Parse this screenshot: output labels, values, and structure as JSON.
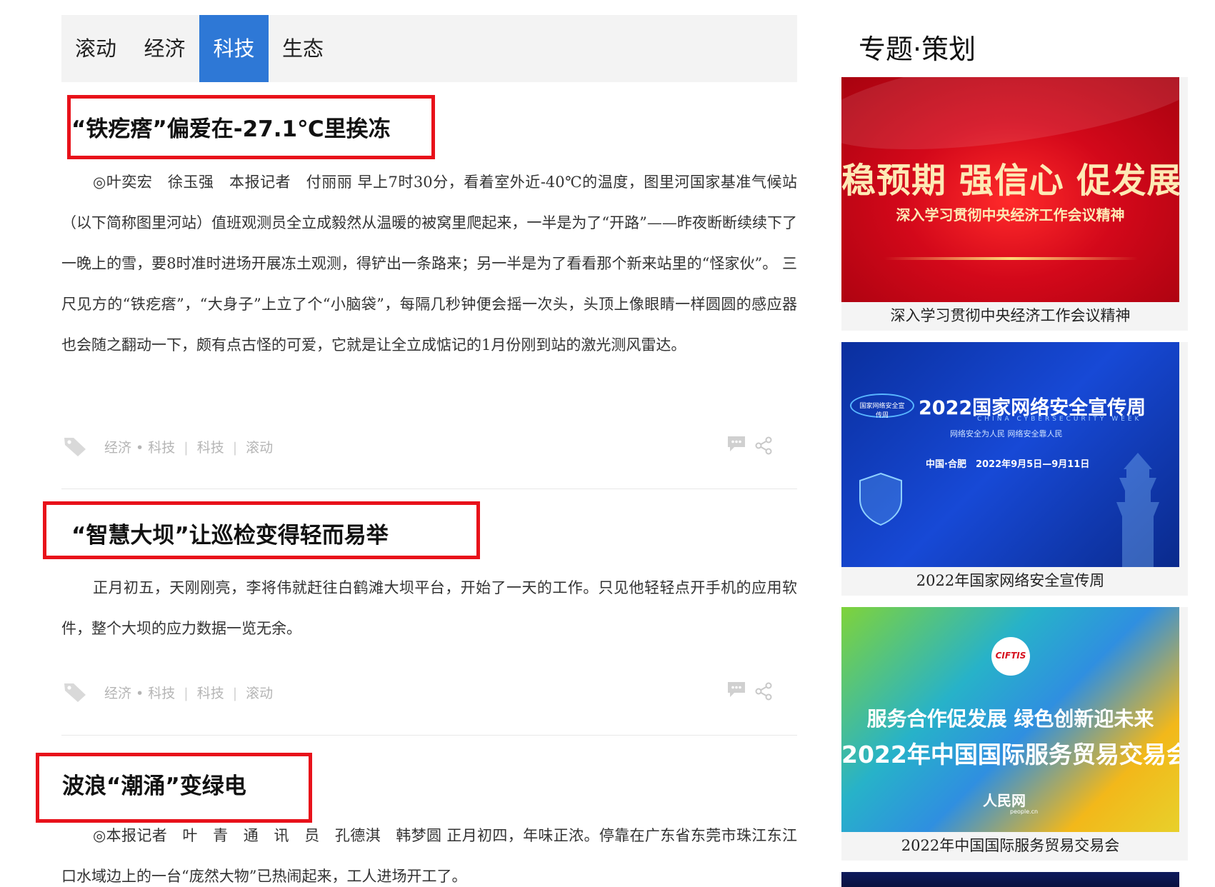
{
  "tabs": [
    {
      "label": "滚动",
      "active": false
    },
    {
      "label": "经济",
      "active": false
    },
    {
      "label": "科技",
      "active": true
    },
    {
      "label": "生态",
      "active": false
    }
  ],
  "articles": [
    {
      "title": "“铁疙瘩”偏爱在-27.1℃里挨冻",
      "body": "◎叶奕宏　徐玉强　本报记者　付丽丽 早上7时30分，看着室外近-40℃的温度，图里河国家基准气候站（以下简称图里河站）值班观测员全立成毅然从温暖的被窝里爬起来，一半是为了“开路”——昨夜断断续续下了一晚上的雪，要8时准时进场开展冻土观测，得铲出一条路来；另一半是为了看看那个新来站里的“怪家伙”。 三尺见方的“铁疙瘩”，“大身子”上立了个“小脑袋”，每隔几秒钟便会摇一次头，头顶上像眼睛一样圆圆的感应器也会随之翻动一下，颇有点古怪的可爱，它就是让全立成惦记的1月份刚到站的激光测风雷达。",
      "tags": [
        "经济 • 科技",
        "科技",
        "滚动"
      ]
    },
    {
      "title": "“智慧大坝”让巡检变得轻而易举",
      "body": "正月初五，天刚刚亮，李将伟就赶往白鹤滩大坝平台，开始了一天的工作。只见他轻轻点开手机的应用软件，整个大坝的应力数据一览无余。",
      "tags": [
        "经济 • 科技",
        "科技",
        "滚动"
      ]
    },
    {
      "title": "波浪“潮涌”变绿电",
      "body": "◎本报记者　叶　青　通　讯　员　孔德淇　韩梦圆 正月初四，年味正浓。停靠在广东省东莞市珠江东江口水域边上的一台“庞然大物”已热闹起来，工人进场开工了。"
    }
  ],
  "sidebar": {
    "heading": "专题·策划",
    "cards": [
      {
        "caption": "深入学习贯彻中央经济工作会议精神",
        "image_text_line1": "稳预期 强信心 促发展",
        "image_text_line2": "深入学习贯彻中央经济工作会议精神"
      },
      {
        "caption": "2022年国家网络安全宣传周",
        "image_logo_text": "国家网络安全宣传周",
        "image_title": "2022国家网络安全宣传周",
        "image_subtitle_en": "CHINA CYBERSECURITY WEEK",
        "image_slogan": "网络安全为人民 网络安全靠人民",
        "image_place_date": "中国·合肥　2022年9月5日—9月11日"
      },
      {
        "caption": "2022年中国国际服务贸易交易会",
        "image_logo": "CIFTIS",
        "image_line1": "服务合作促发展 绿色创新迎未来",
        "image_line2": "2022年中国国际服务贸易交易会",
        "image_brand": "人民网",
        "image_brand_sub": "people.cn"
      }
    ]
  },
  "colors": {
    "accent_tab": "#2e78d6",
    "highlight_box": "#e8111a",
    "tag_text": "#b5b5b5"
  },
  "icons": [
    "tag-icon",
    "comment-icon",
    "share-icon"
  ]
}
